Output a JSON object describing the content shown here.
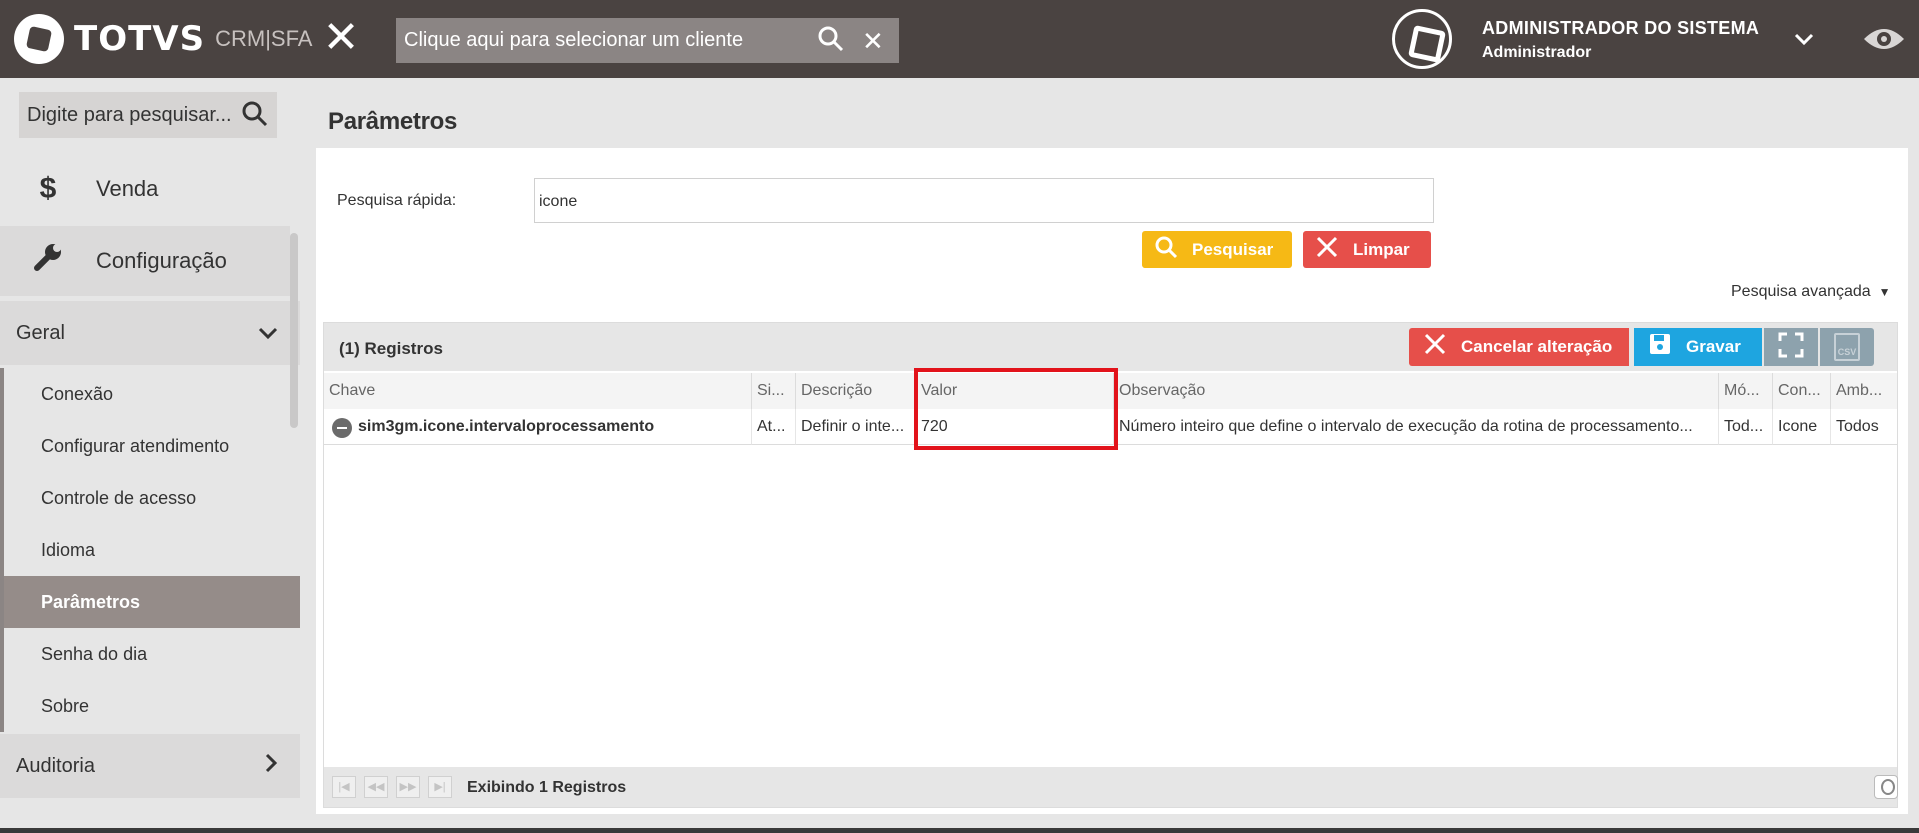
{
  "app": {
    "brand": "TOTVS",
    "product": "CRM|SFA"
  },
  "header": {
    "client_search_placeholder": "Clique aqui para selecionar um cliente",
    "user_name": "ADMINISTRADOR DO SISTEMA",
    "user_role": "Administrador"
  },
  "sidebar": {
    "search_placeholder": "Digite para pesquisar...",
    "items": [
      {
        "label": "Venda",
        "icon": "dollar-icon"
      },
      {
        "label": "Configuração",
        "icon": "wrench-icon"
      }
    ],
    "group_geral": "Geral",
    "sub_items": [
      "Conexão",
      "Configurar atendimento",
      "Controle de acesso",
      "Idioma",
      "Parâmetros",
      "Senha do dia",
      "Sobre"
    ],
    "group_auditoria": "Auditoria"
  },
  "page": {
    "title": "Parâmetros",
    "quick_search_label": "Pesquisa rápida:",
    "quick_search_value": "icone",
    "search_button": "Pesquisar",
    "clear_button": "Limpar",
    "advanced_search": "Pesquisa avançada"
  },
  "grid": {
    "record_count": "(1) Registros",
    "cancel_button": "Cancelar alteração",
    "save_button": "Gravar",
    "csv_label": "CSV",
    "columns": [
      "Chave",
      "Si...",
      "Descrição",
      "Valor",
      "Observação",
      "Mó...",
      "Con...",
      "Amb..."
    ],
    "row": {
      "chave": "sim3gm.icone.intervaloprocessamento",
      "si": "At...",
      "descricao": "Definir o inte...",
      "valor": "720",
      "observacao": "Número inteiro que define o intervalo de execução da rotina de processamento...",
      "modulo": "Tod...",
      "con": "Icone",
      "amb": "Todos"
    },
    "footer_text": "Exibindo 1 Registros"
  },
  "colors": {
    "topbar": "#4a4341",
    "yellow": "#f6b915",
    "red": "#e64f4a",
    "blue": "#1ea5e0",
    "highlight": "#e2131b"
  }
}
